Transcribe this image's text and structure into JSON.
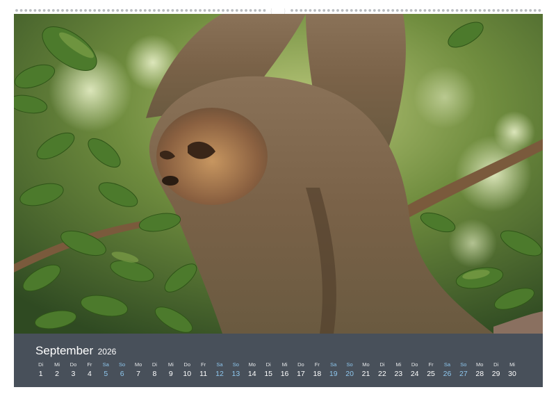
{
  "photo": {
    "subject": "sloth-hanging-in-tree"
  },
  "calendar": {
    "month": "September",
    "year": "2026",
    "weekend_color": "#8ec7ee",
    "bar_color": "#48505a",
    "days": [
      {
        "wd": "Di",
        "n": "1",
        "we": false
      },
      {
        "wd": "Mi",
        "n": "2",
        "we": false
      },
      {
        "wd": "Do",
        "n": "3",
        "we": false
      },
      {
        "wd": "Fr",
        "n": "4",
        "we": false
      },
      {
        "wd": "Sa",
        "n": "5",
        "we": true
      },
      {
        "wd": "So",
        "n": "6",
        "we": true
      },
      {
        "wd": "Mo",
        "n": "7",
        "we": false
      },
      {
        "wd": "Di",
        "n": "8",
        "we": false
      },
      {
        "wd": "Mi",
        "n": "9",
        "we": false
      },
      {
        "wd": "Do",
        "n": "10",
        "we": false
      },
      {
        "wd": "Fr",
        "n": "11",
        "we": false
      },
      {
        "wd": "Sa",
        "n": "12",
        "we": true
      },
      {
        "wd": "So",
        "n": "13",
        "we": true
      },
      {
        "wd": "Mo",
        "n": "14",
        "we": false
      },
      {
        "wd": "Di",
        "n": "15",
        "we": false
      },
      {
        "wd": "Mi",
        "n": "16",
        "we": false
      },
      {
        "wd": "Do",
        "n": "17",
        "we": false
      },
      {
        "wd": "Fr",
        "n": "18",
        "we": false
      },
      {
        "wd": "Sa",
        "n": "19",
        "we": true
      },
      {
        "wd": "So",
        "n": "20",
        "we": true
      },
      {
        "wd": "Mo",
        "n": "21",
        "we": false
      },
      {
        "wd": "Di",
        "n": "22",
        "we": false
      },
      {
        "wd": "Mi",
        "n": "23",
        "we": false
      },
      {
        "wd": "Do",
        "n": "24",
        "we": false
      },
      {
        "wd": "Fr",
        "n": "25",
        "we": false
      },
      {
        "wd": "Sa",
        "n": "26",
        "we": true
      },
      {
        "wd": "So",
        "n": "27",
        "we": true
      },
      {
        "wd": "Mo",
        "n": "28",
        "we": false
      },
      {
        "wd": "Di",
        "n": "29",
        "we": false
      },
      {
        "wd": "Mi",
        "n": "30",
        "we": false
      }
    ]
  }
}
